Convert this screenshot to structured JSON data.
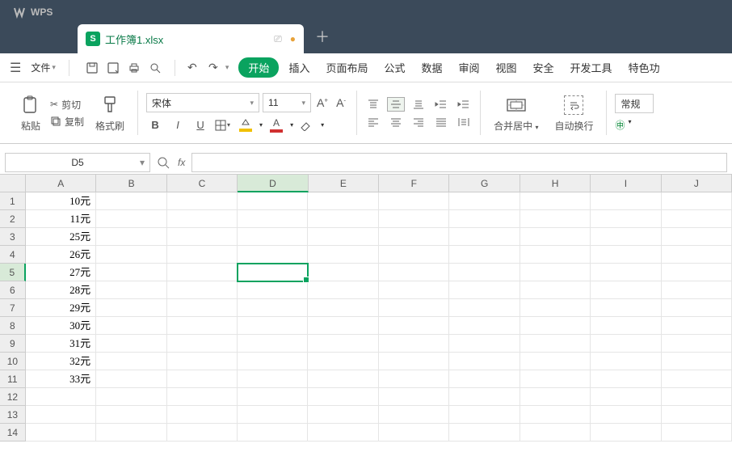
{
  "titlebar": {
    "app_name": "WPS",
    "doc_name": "工作簿1.xlsx"
  },
  "menubar": {
    "file_label": "文件",
    "tabs": [
      "开始",
      "插入",
      "页面布局",
      "公式",
      "数据",
      "审阅",
      "视图",
      "安全",
      "开发工具",
      "特色功"
    ],
    "active_index": 0
  },
  "ribbon": {
    "paste": "粘贴",
    "cut": "剪切",
    "copy": "复制",
    "format_painter": "格式刷",
    "font_name": "宋体",
    "font_size": "11",
    "merge_center": "合并居中",
    "wrap_text": "自动换行",
    "style_normal": "常规"
  },
  "formula_bar": {
    "active_cell": "D5",
    "fx_label": "fx"
  },
  "grid": {
    "columns": [
      "A",
      "B",
      "C",
      "D",
      "E",
      "F",
      "G",
      "H",
      "I",
      "J"
    ],
    "num_rows": 14,
    "selected": {
      "row": 5,
      "col": 4
    },
    "cells": {
      "A1": "10元",
      "A2": "11元",
      "A3": "25元",
      "A4": "26元",
      "A5": "27元",
      "A6": "28元",
      "A7": "29元",
      "A8": "30元",
      "A9": "31元",
      "A10": "32元",
      "A11": "33元"
    }
  }
}
